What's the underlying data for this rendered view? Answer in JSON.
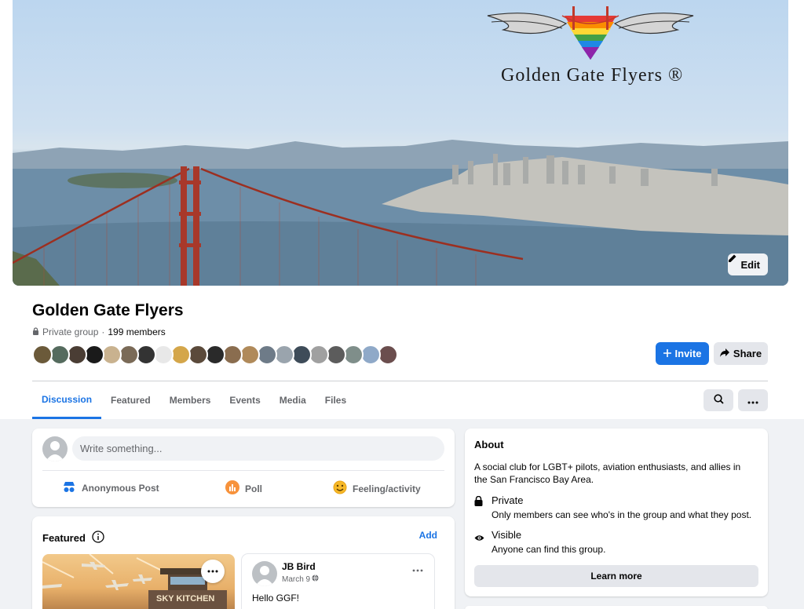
{
  "cover": {
    "logo_text": "Golden Gate Flyers ®",
    "edit_label": "Edit"
  },
  "group": {
    "name": "Golden Gate Flyers",
    "privacy": "Private group",
    "separator": " · ",
    "members": "199 members"
  },
  "actions": {
    "invite_label": "Invite",
    "share_label": "Share"
  },
  "tabs": [
    {
      "label": "Discussion",
      "active": true
    },
    {
      "label": "Featured",
      "active": false
    },
    {
      "label": "Members",
      "active": false
    },
    {
      "label": "Events",
      "active": false
    },
    {
      "label": "Media",
      "active": false
    },
    {
      "label": "Files",
      "active": false
    }
  ],
  "composer": {
    "placeholder": "Write something...",
    "anonymous_label": "Anonymous Post",
    "poll_label": "Poll",
    "feeling_label": "Feeling/activity"
  },
  "featured": {
    "title": "Featured",
    "add_label": "Add",
    "image_caption": "SKY KITCHEN",
    "post": {
      "author": "JB Bird",
      "date": "March 9",
      "text": "Hello GGF!"
    }
  },
  "about": {
    "title": "About",
    "description": "A social club for LGBT+ pilots, aviation enthusiasts, and allies in the San Francisco Bay Area.",
    "private_title": "Private",
    "private_sub": "Only members can see who's in the group and what they post.",
    "visible_title": "Visible",
    "visible_sub": "Anyone can find this group.",
    "learn_more_label": "Learn more"
  },
  "colors": {
    "accent": "#1b74e4",
    "background": "#f0f2f5"
  },
  "avatar_colors": [
    "#6b5a3a",
    "#556b5e",
    "#4a3d34",
    "#1a1a1a",
    "#c9b28f",
    "#7a6a57",
    "#333333",
    "#e8e8e8",
    "#d4a64a",
    "#5b4a3b",
    "#2a2a2a",
    "#8a6d4f",
    "#b08a5a",
    "#6e7b88",
    "#9aa4ad",
    "#3e4c59",
    "#a0a0a0",
    "#5c5c5c",
    "#7f8e8a",
    "#8fa9c8",
    "#6b4e4e"
  ]
}
